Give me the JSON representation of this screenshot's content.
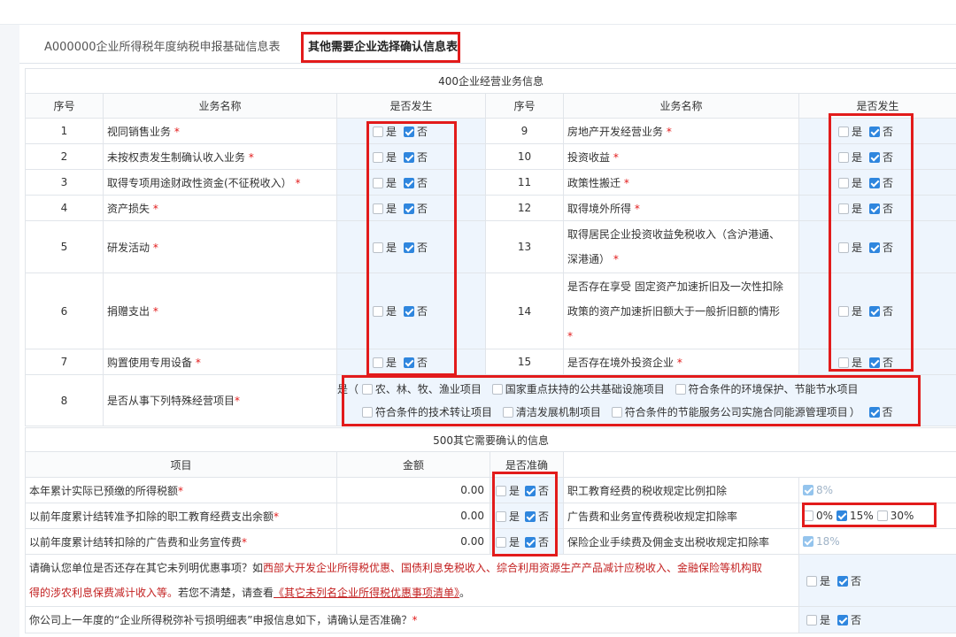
{
  "tabs": {
    "basic": "A000000企业所得税年度纳税申报基础信息表",
    "other": "其他需要企业选择确认信息表"
  },
  "section400": {
    "title": "400企业经营业务信息",
    "headers": {
      "seq": "序号",
      "name": "业务名称",
      "occurred": "是否发生"
    },
    "rows_left": [
      {
        "seq": "1",
        "name": "视同销售业务"
      },
      {
        "seq": "2",
        "name": "未按权责发生制确认收入业务"
      },
      {
        "seq": "3",
        "name": "取得专项用途财政性资金(不征税收入）"
      },
      {
        "seq": "4",
        "name": "资产损失"
      },
      {
        "seq": "5",
        "name": "研发活动"
      },
      {
        "seq": "6",
        "name": "捐赠支出"
      },
      {
        "seq": "7",
        "name": "购置使用专用设备"
      }
    ],
    "rows_right": [
      {
        "seq": "9",
        "name": "房地产开发经营业务"
      },
      {
        "seq": "10",
        "name": "投资收益"
      },
      {
        "seq": "11",
        "name": "政策性搬迁"
      },
      {
        "seq": "12",
        "name": "取得境外所得"
      },
      {
        "seq": "13",
        "name_line1": "取得居民企业投资收益免税收入（含沪港通、",
        "name_line2": "深港通）"
      },
      {
        "seq": "14",
        "name_line1": "是否存在享受 固定资产加速折旧及一次性扣除",
        "name_line2": "政策的资产加速折旧额大于一般折旧额的情形"
      },
      {
        "seq": "15",
        "name": "是否存在境外投资企业"
      }
    ],
    "yes": "是",
    "no": "否",
    "row8": {
      "seq": "8",
      "name": "是否从事下列特殊经营项目",
      "prefix": "是（",
      "options_line1": [
        "农、林、牧、渔业项目",
        "国家重点扶持的公共基础设施项目",
        "符合条件的环境保护、节能节水项目"
      ],
      "options_line2": [
        "符合条件的技术转让项目",
        "清洁发展机制项目",
        "符合条件的节能服务公司实施合同能源管理项目"
      ],
      "suffix": "）",
      "no": "否"
    }
  },
  "section500": {
    "title": "500其它需要确认的信息",
    "headers": {
      "item": "项目",
      "amount": "金额",
      "accurate": "是否准确"
    },
    "rows": [
      {
        "item": "本年累计实际已预缴的所得税额",
        "amount": "0.00",
        "right_label": "职工教育经费的税收规定比例扣除",
        "rate": "8%"
      },
      {
        "item": "以前年度累计结转准予扣除的职工教育经费支出余额",
        "amount": "0.00",
        "right_label": "广告费和业务宣传费税收规定扣除率",
        "rates": [
          "0%",
          "15%",
          "30%"
        ]
      },
      {
        "item": "以前年度累计结转扣除的广告费和业务宣传费",
        "amount": "0.00",
        "right_label": "保险企业手续费及佣金支出税收规定扣除率",
        "rate": "18%"
      }
    ],
    "confirm1_part1": "请确认您单位是否还存在其它未列明优惠事项？如",
    "confirm1_red1": "西部大开发企业所得税优惠、国债利息免税收入、综合利用资源生产产品减计应税收入、金融保险等机构取",
    "confirm1_red2": "得的涉农利息保费减计收入等。",
    "confirm1_part2": "若您不清楚，请查看",
    "confirm1_link": "《其它未列名企业所得税优惠事项清单》",
    "confirm1_end": "。",
    "confirm2": "你公司上一年度的“企业所得税弥补亏损明细表”申报信息如下，请确认是否准确？"
  }
}
